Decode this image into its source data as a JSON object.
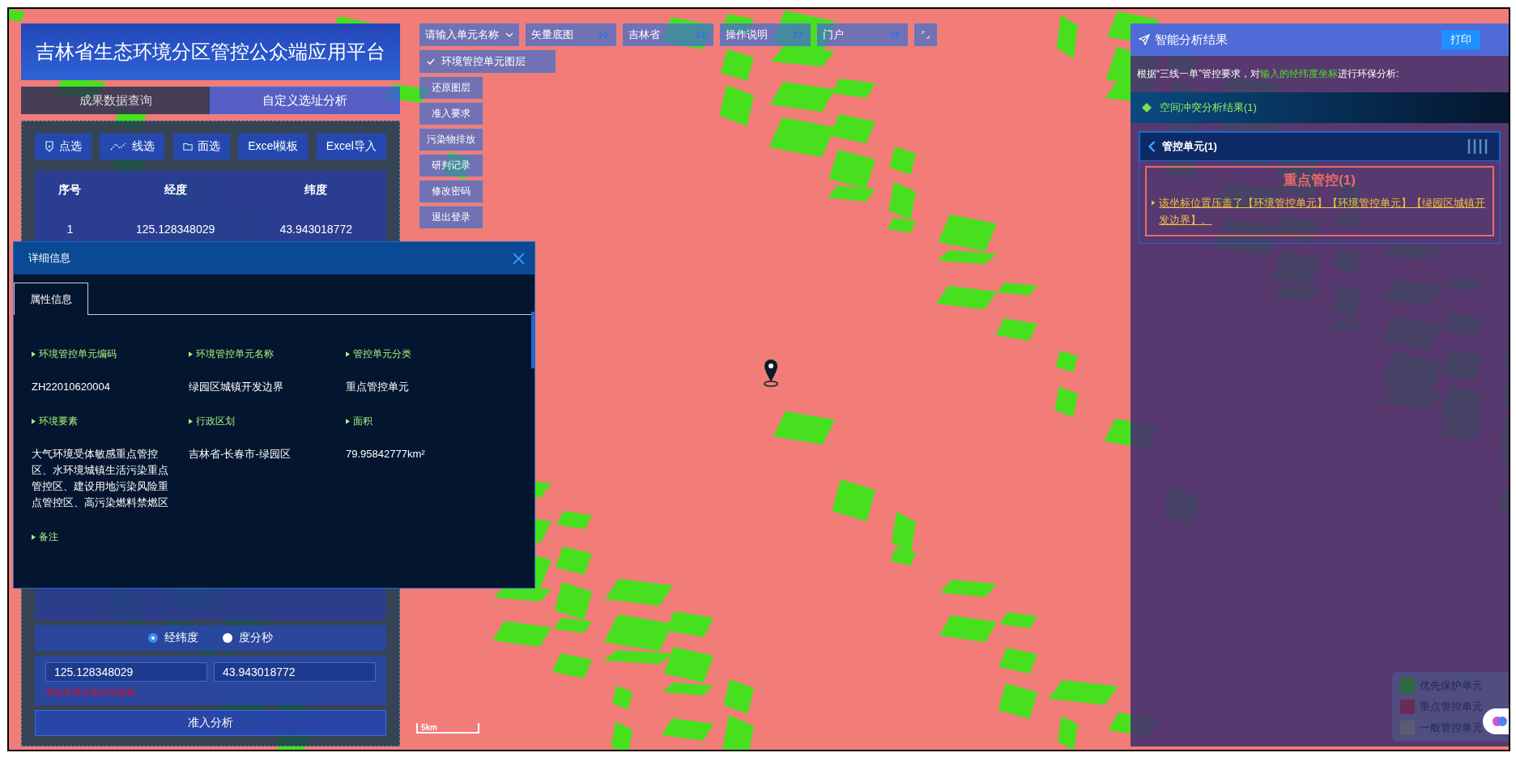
{
  "left_panel": {
    "title": "吉林省生态环境分区管控公众端应用平台",
    "tabs": [
      {
        "label": "成果数据查询",
        "selected": false
      },
      {
        "label": "自定义选址分析",
        "selected": true
      }
    ],
    "tools": [
      {
        "label": "点选",
        "kind": "point"
      },
      {
        "label": "线选",
        "kind": "line"
      },
      {
        "label": "面选",
        "kind": "area"
      },
      {
        "label": "Excel模板",
        "kind": "text"
      },
      {
        "label": "Excel导入",
        "kind": "text"
      }
    ],
    "table": {
      "columns": [
        "序号",
        "经度",
        "纬度"
      ],
      "rows": [
        [
          "1",
          "125.128348029",
          "43.943018772"
        ]
      ]
    },
    "coord_modes": [
      {
        "label": "经纬度",
        "selected": true
      },
      {
        "label": "度分秒",
        "selected": false
      }
    ],
    "longitude": "125.128348029",
    "latitude": "43.943018772",
    "hint": "系统采用大地2000坐标",
    "submit": "准入分析"
  },
  "detail_dialog": {
    "title": "详细信息",
    "tabs": [
      {
        "label": "属性信息",
        "selected": true
      }
    ],
    "fields": [
      {
        "label": "环境管控单元编码",
        "value": "ZH22010620004"
      },
      {
        "label": "环境管控单元名称",
        "value": "绿园区城镇开发边界"
      },
      {
        "label": "管控单元分类",
        "value": "重点管控单元"
      },
      {
        "label": "环境要素",
        "value": "大气环境受体敏感重点管控区、水环境城镇生活污染重点管控区、建设用地污染风险重点管控区、高污染燃料禁燃区"
      },
      {
        "label": "行政区划",
        "value": "吉林省-长春市-绿园区"
      },
      {
        "label": "面积",
        "value": "79.95842777km²"
      },
      {
        "label": "备注"
      }
    ]
  },
  "toolbar": {
    "unit_select": {
      "placeholder": "请输入单元名称"
    },
    "menus": [
      "矢量底图",
      "吉林省",
      "操作说明",
      "门户"
    ]
  },
  "layer_toggle": {
    "label": "环境管控单元图层",
    "checked": true
  },
  "side_buttons": [
    "还原图层",
    "准入要求",
    "污染物排放",
    "研判记录",
    "修改密码",
    "退出登录"
  ],
  "scale": "5km",
  "result_panel": {
    "title": "智能分析结果",
    "print": "打印",
    "intro": {
      "before": "根据“三线一单”管控要求，对",
      "highlight": "输入的经纬度坐标",
      "after": "进行环保分析:"
    },
    "section": "空间冲突分析结果(1)",
    "card_title": "管控单元(1)",
    "result": {
      "heading": "重点管控(1)",
      "text": "该坐标位置压盖了【环境管控单元】【环境管控单元】【绿园区城镇开发边界】。"
    }
  },
  "legend": [
    {
      "label": "优先保护单元",
      "color": "#2f6a3c"
    },
    {
      "label": "重点管控单元",
      "color": "#6a2c56"
    },
    {
      "label": "一般管控单元",
      "color": "#5c5c70"
    }
  ]
}
